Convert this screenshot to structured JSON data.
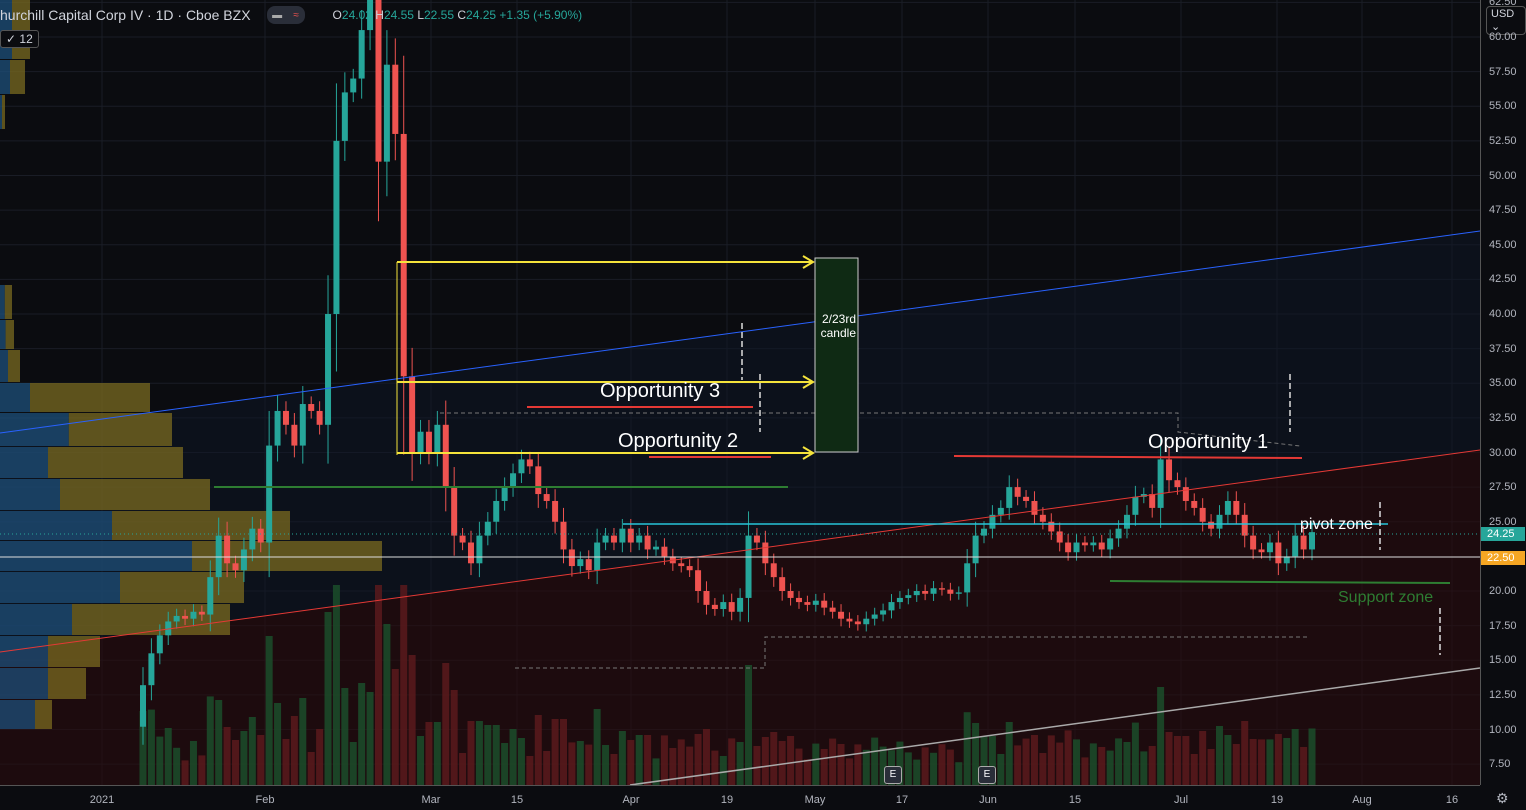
{
  "header": {
    "title": "hurchill Capital Corp IV · 1D · Cboe BZX",
    "open_label": "O",
    "open": "24.02",
    "high_label": "H",
    "high": "24.55",
    "low_label": "L",
    "low": "22.55",
    "close_label": "C",
    "close": "24.25",
    "change": "+1.35 (+5.90%)",
    "volume_indicator": "12"
  },
  "currency": "USD",
  "price_axis": [
    "62.50",
    "60.00",
    "57.50",
    "55.00",
    "52.50",
    "50.00",
    "47.50",
    "45.00",
    "42.50",
    "40.00",
    "37.50",
    "35.00",
    "32.50",
    "30.00",
    "27.50",
    "25.00",
    "20.00",
    "17.50",
    "15.00",
    "12.50",
    "10.00",
    "7.50"
  ],
  "price_badges": {
    "last": "24.25",
    "line": "22.50"
  },
  "time_axis": [
    "2021",
    "Feb",
    "Mar",
    "15",
    "Apr",
    "19",
    "May",
    "17",
    "Jun",
    "15",
    "Jul",
    "19",
    "Aug",
    "16"
  ],
  "earnings_markers": [
    "E",
    "E"
  ],
  "annotations": {
    "opp3": "Opportunity 3",
    "opp2": "Opportunity 2",
    "opp1": "Opportunity 1",
    "pivot": "pivot zone",
    "support": "Support zone",
    "candle_note": "2/23rd candle"
  },
  "colors": {
    "up": "#26a69a",
    "down": "#ef5350",
    "yellow": "#f5e33b",
    "blue": "#2962ff",
    "red": "#e53935",
    "teal": "#26c6da",
    "green": "#2e7d32"
  },
  "chart_data": {
    "type": "candlestick",
    "start_price": 10.2,
    "closes": [
      13.2,
      15.5,
      16.8,
      17.8,
      18.2,
      18.0,
      18.5,
      18.3,
      21,
      24,
      22,
      21.5,
      23,
      24.5,
      23.5,
      30.5,
      33,
      32,
      30.5,
      33.5,
      33,
      32,
      40,
      52.5,
      56,
      57,
      60.5,
      64,
      51,
      58,
      53,
      35.5,
      30,
      31.5,
      30,
      32,
      27.5,
      24,
      23.5,
      22,
      24,
      25,
      26.5,
      27.5,
      28.5,
      29.5,
      29,
      27,
      26.5,
      25,
      23,
      21.8,
      22.3,
      21.5,
      23.5,
      24,
      23.5,
      24.5,
      23.5,
      24,
      23,
      23.2,
      22.5,
      22,
      21.8,
      21.5,
      20,
      19,
      18.7,
      19.2,
      18.5,
      19.5,
      24,
      23.5,
      22,
      21,
      20,
      19.5,
      19.2,
      19,
      19.3,
      18.8,
      18.5,
      18,
      17.8,
      17.6,
      18,
      18.3,
      18.6,
      19.2,
      19.5,
      19.7,
      20,
      19.8,
      20.2,
      20.1,
      19.8,
      19.9,
      22,
      24,
      24.5,
      25.5,
      26,
      27.5,
      26.8,
      26.5,
      25.5,
      25,
      24.3,
      23.5,
      22.8,
      23.5,
      23.3,
      23.5,
      23,
      23.8,
      24.5,
      25.5,
      26.8,
      27,
      26,
      29.5,
      28,
      27.5,
      26.5,
      26,
      25,
      24.5,
      25.5,
      26.5,
      25.5,
      24,
      23,
      22.8,
      23.5,
      22,
      22.5,
      24,
      23,
      24.25
    ],
    "ylim": [
      6,
      63
    ]
  }
}
